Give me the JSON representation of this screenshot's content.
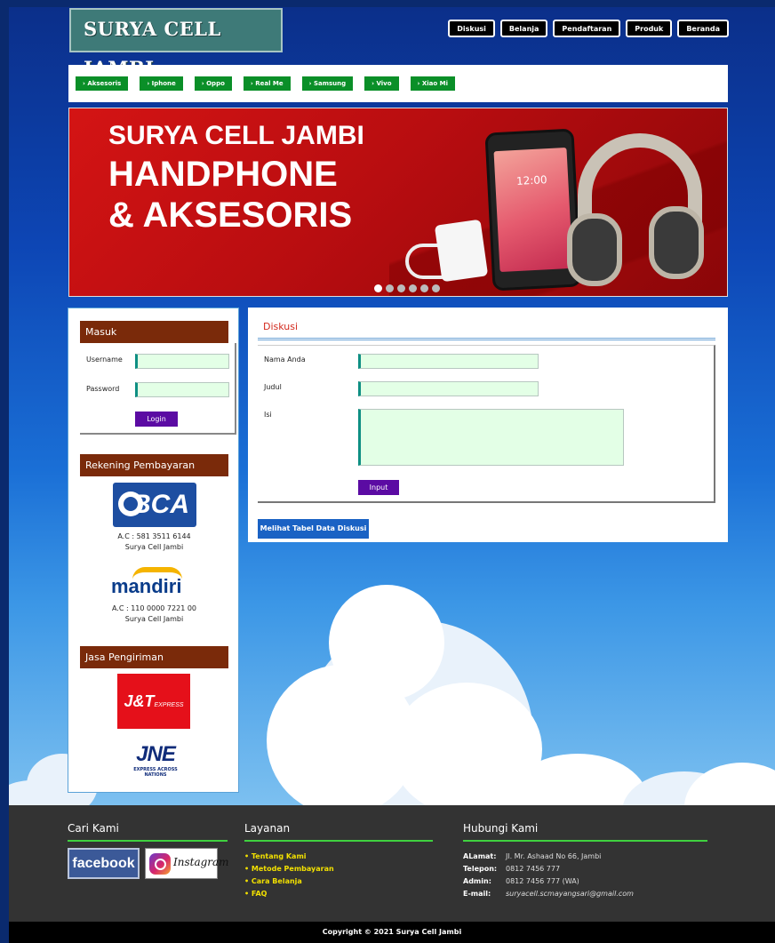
{
  "header": {
    "logo": "SURYA CELL JAMBI",
    "nav": [
      "Diskusi",
      "Belanja",
      "Pendaftaran",
      "Produk",
      "Beranda"
    ]
  },
  "categories": [
    "› Aksesoris",
    "› Iphone",
    "› Oppo",
    "› Real Me",
    "› Samsung",
    "› Vivo",
    "› Xiao Mi"
  ],
  "banner": {
    "line1": "SURYA CELL JAMBI",
    "line2": "HANDPHONE",
    "line3": "& AKSESORIS",
    "phone_time": "12:00",
    "slides": 6,
    "active_slide": 1
  },
  "sidebar": {
    "login": {
      "heading": "Masuk",
      "username_label": "Username",
      "password_label": "Password",
      "button": "Login"
    },
    "payment": {
      "heading": "Rekening Pembayaran",
      "bca_logo": "BCA",
      "bca_account": "A.C : 581 3511 6144",
      "bca_name": "Surya Cell Jambi",
      "mandiri_logo": "mandiri",
      "mandiri_account": "A.C : 110 0000 7221 00",
      "mandiri_name": "Surya Cell Jambi"
    },
    "shipping": {
      "heading": "Jasa Pengiriman",
      "jnt_logo": "J&T",
      "jnt_sub": "EXPRESS",
      "jne_logo": "JNE",
      "jne_tag": "EXPRESS ACROSS NATIONS"
    }
  },
  "main": {
    "title": "Diskusi",
    "name_label": "Nama Anda",
    "subject_label": "Judul",
    "content_label": "Isi",
    "submit": "Input",
    "view_table": "Melihat Tabel Data Diskusi"
  },
  "footer": {
    "find_us": {
      "heading": "Cari Kami",
      "facebook": "facebook",
      "instagram": "Instagram"
    },
    "services": {
      "heading": "Layanan",
      "items": [
        "• Tentang Kami",
        "• Metode Pembayaran",
        "• Cara Belanja",
        "• FAQ"
      ]
    },
    "contact": {
      "heading": "Hubungi Kami",
      "address_label": "ALamat:",
      "address": "Jl. Mr. Ashaad No 66, Jambi",
      "phone_label": "Telepon:",
      "phone": "0812 7456 777",
      "admin_label": "Admin:",
      "admin": "0812 7456 777 (WA)",
      "email_label": "E-mail:",
      "email": "suryacell.scmayangsari@gmail.com"
    },
    "copyright": "Copyright © 2021 Surya Cell Jambi"
  },
  "colors": {
    "nav_bg": "#000000",
    "category_bg": "#0a8f28",
    "sidebar_heading": "#7a2a0a",
    "button_purple": "#5b0ba3",
    "view_button": "#1a62c4",
    "footer_bg": "#333333",
    "accent_green": "#3fd13f",
    "link_yellow": "#f2e000"
  }
}
